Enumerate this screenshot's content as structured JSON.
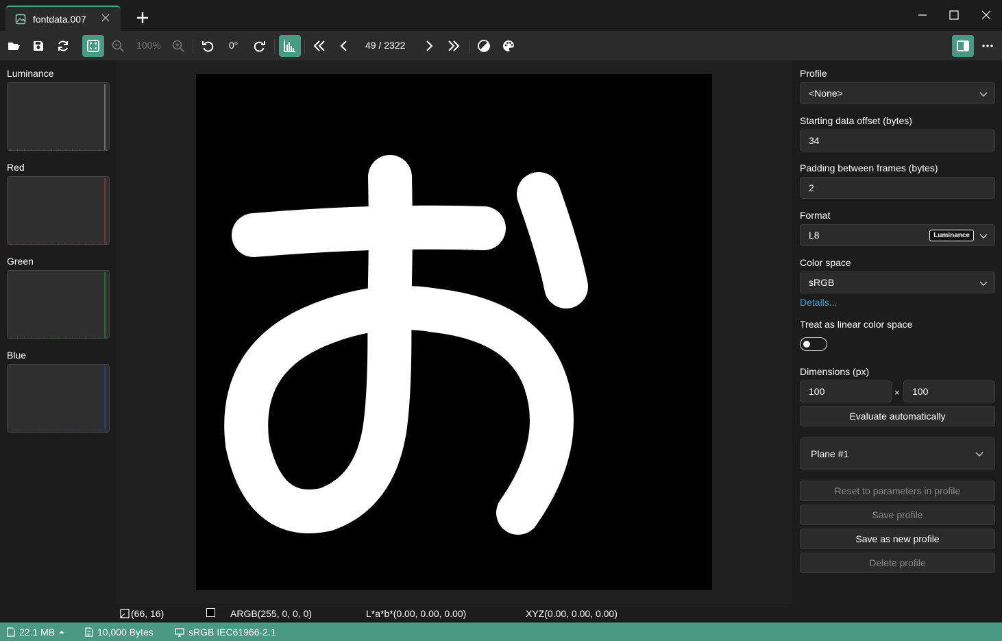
{
  "tab": {
    "title": "fontdata.007"
  },
  "toolbar": {
    "zoom": "100%",
    "rotation": "0°",
    "frame_counter": "49 / 2322"
  },
  "histograms": [
    {
      "label": "Luminance",
      "color": "#b0b0b0"
    },
    {
      "label": "Red",
      "color": "#c04040"
    },
    {
      "label": "Green",
      "color": "#40a040"
    },
    {
      "label": "Blue",
      "color": "#4040c0"
    }
  ],
  "settings": {
    "profile_label": "Profile",
    "profile_value": "<None>",
    "offset_label": "Starting data offset (bytes)",
    "offset_value": "34",
    "padding_label": "Padding between frames (bytes)",
    "padding_value": "2",
    "format_label": "Format",
    "format_value": "L8",
    "format_badge": "Luminance",
    "colorspace_label": "Color space",
    "colorspace_value": "sRGB",
    "details_link": "Details...",
    "linear_label": "Treat as linear color space",
    "linear_on": false,
    "dimensions_label": "Dimensions (px)",
    "width": "100",
    "times": "×",
    "height": "100",
    "evaluate_button": "Evaluate automatically",
    "plane": "Plane #1",
    "reset_button": "Reset to parameters in profile",
    "save_button": "Save profile",
    "save_new_button": "Save as new profile",
    "delete_button": "Delete profile"
  },
  "statusline": {
    "coords": "(66, 16)",
    "argb": "ARGB(255, 0, 0, 0)",
    "lab": "L*a*b*(0.00, 0.00, 0.00)",
    "xyz": "XYZ(0.00, 0.00, 0.00)"
  },
  "footer": {
    "file_size": "22.1 MB",
    "data_size": "10,000 Bytes",
    "color_profile": "sRGB IEC61966-2.1"
  },
  "colors": {
    "accent": "#4a9a82",
    "link": "#3e9fe0"
  }
}
